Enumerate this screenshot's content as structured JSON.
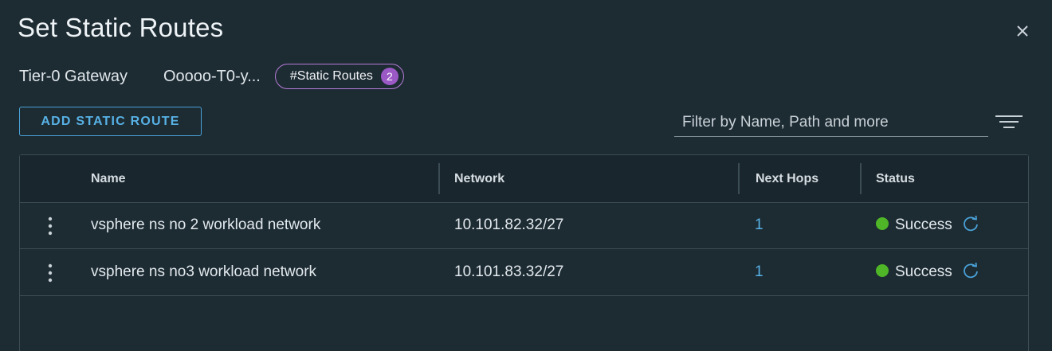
{
  "dialog": {
    "title": "Set Static Routes"
  },
  "gateway": {
    "label": "Tier-0 Gateway",
    "value": "Ooooo-T0-y...",
    "static_routes_label": "#Static Routes",
    "static_routes_count": "2"
  },
  "toolbar": {
    "add_label": "ADD STATIC ROUTE",
    "filter_placeholder": "Filter by Name, Path and more"
  },
  "table": {
    "columns": [
      "Name",
      "Network",
      "Next Hops",
      "Status"
    ],
    "rows": [
      {
        "name": "vsphere ns no 2 workload network",
        "network": "10.101.82.32/27",
        "next_hops": "1",
        "status": "Success"
      },
      {
        "name": "vsphere ns no3 workload network",
        "network": "10.101.83.32/27",
        "next_hops": "1",
        "status": "Success"
      }
    ]
  },
  "colors": {
    "background": "#1d2b33",
    "accent_blue": "#58b2e6",
    "pill_purple": "#b67ed9",
    "badge_purple": "#9b59c6",
    "success_green": "#4fb628"
  },
  "icons": {
    "close": "close-icon",
    "filter": "filter-lines-icon",
    "row_menu": "kebab-menu-icon",
    "status": "success-dot-icon",
    "refresh": "refresh-icon"
  }
}
